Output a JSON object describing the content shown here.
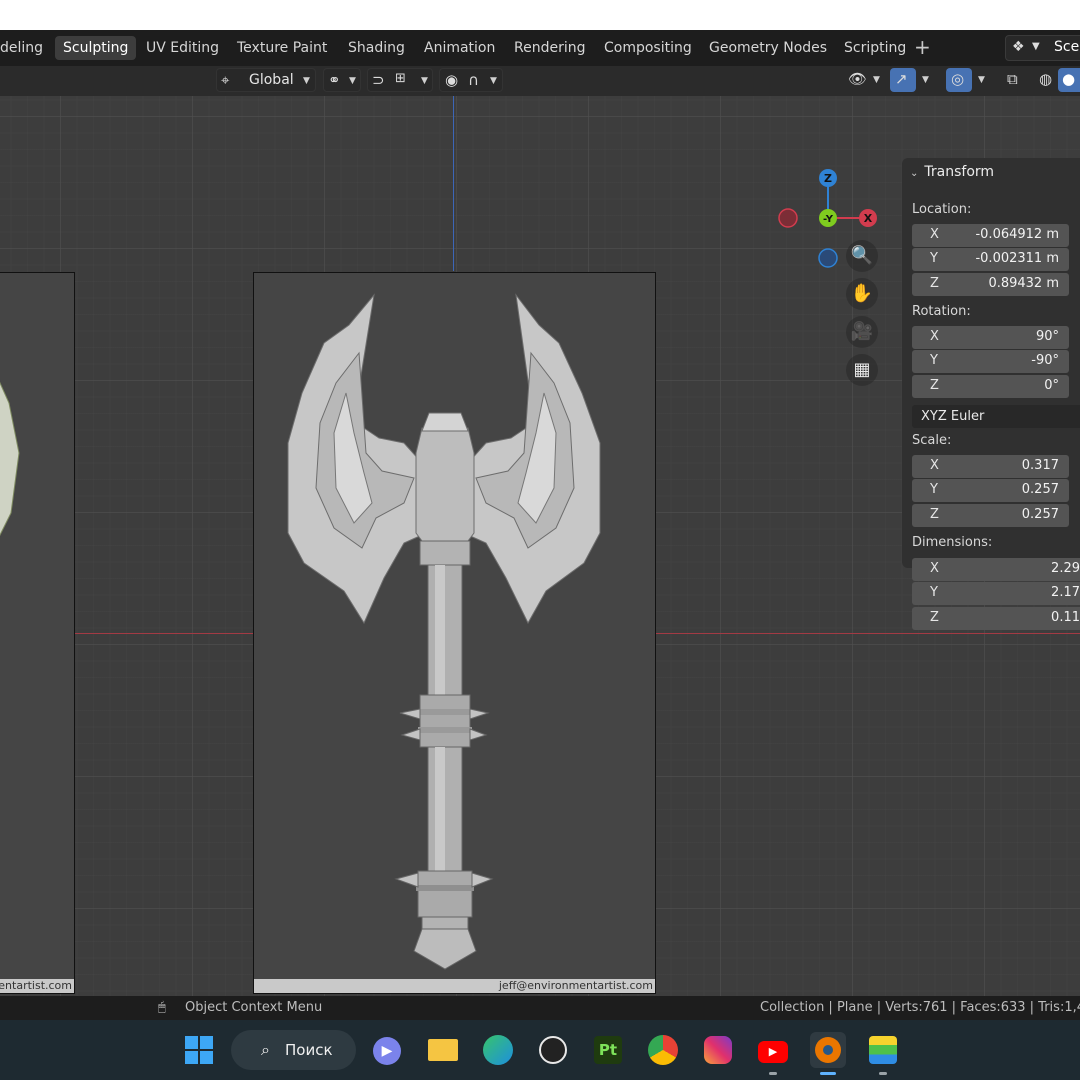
{
  "workspace_tabs": [
    {
      "label": "deling",
      "active": false
    },
    {
      "label": "Sculpting",
      "active": true
    },
    {
      "label": "UV Editing",
      "active": false
    },
    {
      "label": "Texture Paint",
      "active": false
    },
    {
      "label": "Shading",
      "active": false
    },
    {
      "label": "Animation",
      "active": false
    },
    {
      "label": "Rendering",
      "active": false
    },
    {
      "label": "Compositing",
      "active": false
    },
    {
      "label": "Geometry Nodes",
      "active": false
    },
    {
      "label": "Scripting",
      "active": false
    }
  ],
  "scene": {
    "label": "Scen"
  },
  "header": {
    "orientation": "Global"
  },
  "viewport": {
    "watermark_left": "entartist.com",
    "watermark_main": "jeff@environmentartist.com",
    "gizmo": {
      "x": "X",
      "y": "-Y",
      "z": "Z",
      "x_color": "#d23c4e",
      "y_color": "#7fcc1f",
      "z_color": "#2f82d4"
    }
  },
  "transform_panel": {
    "title": "Transform",
    "location_label": "Location:",
    "location": {
      "x": "-0.064912 m",
      "y": "-0.002311 m",
      "z": "0.89432 m"
    },
    "rotation_label": "Rotation:",
    "rotation": {
      "x": "90°",
      "y": "-90°",
      "z": "0°"
    },
    "rotation_mode": "XYZ Euler",
    "scale_label": "Scale:",
    "scale": {
      "x": "0.317",
      "y": "0.257",
      "z": "0.257"
    },
    "dimensions_label": "Dimensions:",
    "dimensions": {
      "x": "2.29",
      "y": "2.17",
      "z": "0.11"
    },
    "axis_labels": {
      "x": "X",
      "y": "Y",
      "z": "Z"
    }
  },
  "statusbar": {
    "left": "Object Context Menu",
    "right": "Collection | Plane | Verts:761 | Faces:633 | Tris:1,4"
  },
  "taskbar": {
    "search_label": "Поиск",
    "photoshop_label": "Pt"
  }
}
